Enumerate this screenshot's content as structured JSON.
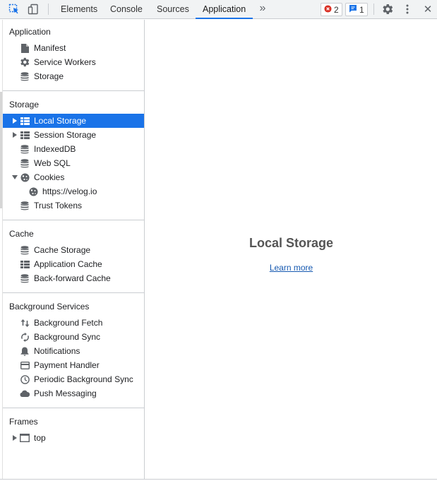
{
  "toolbar": {
    "tabs": [
      "Elements",
      "Console",
      "Sources",
      "Application"
    ],
    "more": "»",
    "errors_count": "2",
    "messages_count": "1",
    "close": "✕"
  },
  "sidebar": {
    "application": {
      "title": "Application",
      "items": [
        "Manifest",
        "Service Workers",
        "Storage"
      ]
    },
    "storage": {
      "title": "Storage",
      "items": [
        "Local Storage",
        "Session Storage",
        "IndexedDB",
        "Web SQL",
        "Cookies",
        "https://velog.io",
        "Trust Tokens"
      ]
    },
    "cache": {
      "title": "Cache",
      "items": [
        "Cache Storage",
        "Application Cache",
        "Back-forward Cache"
      ]
    },
    "background": {
      "title": "Background Services",
      "items": [
        "Background Fetch",
        "Background Sync",
        "Notifications",
        "Payment Handler",
        "Periodic Background Sync",
        "Push Messaging"
      ]
    },
    "frames": {
      "title": "Frames",
      "items": [
        "top"
      ]
    }
  },
  "main": {
    "title": "Local Storage",
    "link": "Learn more"
  },
  "colors": {
    "accent": "#1a73e8",
    "error": "#d93025",
    "link": "#1558b0"
  }
}
